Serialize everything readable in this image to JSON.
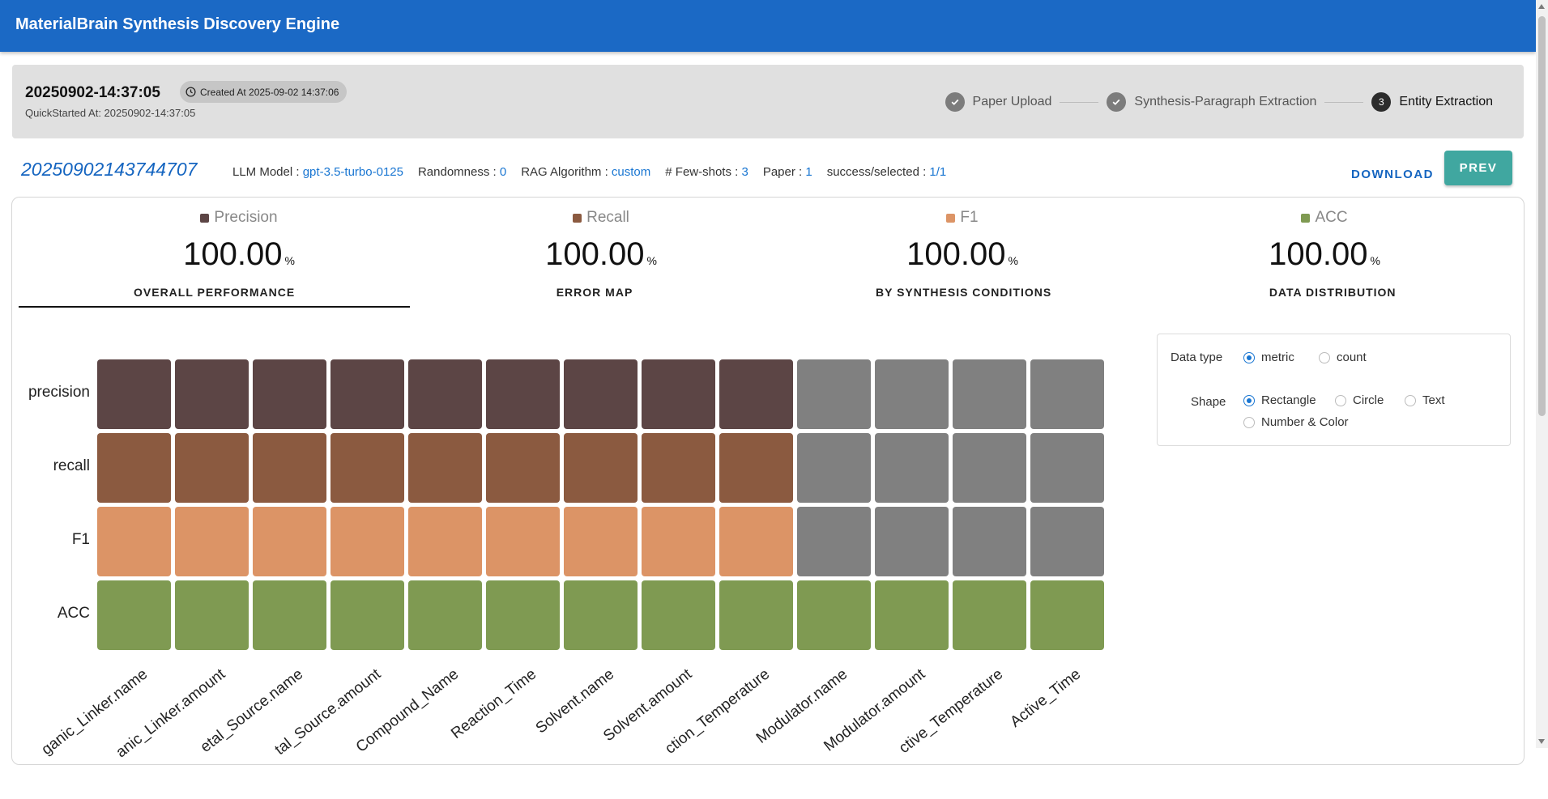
{
  "app": {
    "title": "MaterialBrain Synthesis Discovery Engine"
  },
  "run": {
    "id": "20250902-14:37:05",
    "created_at": "Created At 2025-09-02 14:37:06",
    "quickstarted_at": "QuickStarted At: 20250902-14:37:05"
  },
  "stepper": {
    "steps": [
      {
        "label": "Paper Upload",
        "state": "done"
      },
      {
        "label": "Synthesis-Paragraph Extraction",
        "state": "done"
      },
      {
        "label": "Entity Extraction",
        "state": "active",
        "number": "3"
      }
    ]
  },
  "experiment": {
    "id": "20250902143744707",
    "llm_model_label": "LLM Model : ",
    "llm_model": "gpt-3.5-turbo-0125",
    "randomness_label": "Randomness : ",
    "randomness": "0",
    "rag_label": "RAG Algorithm : ",
    "rag": "custom",
    "fewshots_label": "# Few-shots : ",
    "fewshots": "3",
    "paper_label": "Paper : ",
    "paper": "1",
    "success_label": "success/selected : ",
    "success": "1/1",
    "download_label": "DOWNLOAD",
    "prev_label": "PREV"
  },
  "metrics": [
    {
      "name": "Precision",
      "value": "100.00",
      "unit": "%",
      "color": "#5c4545"
    },
    {
      "name": "Recall",
      "value": "100.00",
      "unit": "%",
      "color": "#8b5a40"
    },
    {
      "name": "F1",
      "value": "100.00",
      "unit": "%",
      "color": "#dc9466"
    },
    {
      "name": "ACC",
      "value": "100.00",
      "unit": "%",
      "color": "#7f9a52"
    }
  ],
  "tabs": [
    {
      "label": "OVERALL PERFORMANCE",
      "active": true
    },
    {
      "label": "ERROR MAP",
      "active": false
    },
    {
      "label": "BY SYNTHESIS CONDITIONS",
      "active": false
    },
    {
      "label": "DATA DISTRIBUTION",
      "active": false
    }
  ],
  "heatmap": {
    "rows": [
      "precision",
      "recall",
      "F1",
      "ACC"
    ],
    "row_colors": [
      "#5c4545",
      "#8b5a40",
      "#dc9466",
      "#7f9a52"
    ],
    "inactive_color": "#808080",
    "columns": [
      "ganic_Linker.name",
      "anic_Linker.amount",
      "etal_Source.name",
      "tal_Source.amount",
      "Compound_Name",
      "Reaction_Time",
      "Solvent.name",
      "Solvent.amount",
      "ction_Temperature",
      "Modulator.name",
      "Modulator.amount",
      "ctive_Temperature",
      "Active_Time"
    ],
    "active": [
      [
        true,
        true,
        true,
        true,
        true,
        true,
        true,
        true,
        true,
        false,
        false,
        false,
        false
      ],
      [
        true,
        true,
        true,
        true,
        true,
        true,
        true,
        true,
        true,
        false,
        false,
        false,
        false
      ],
      [
        true,
        true,
        true,
        true,
        true,
        true,
        true,
        true,
        true,
        false,
        false,
        false,
        false
      ],
      [
        true,
        true,
        true,
        true,
        true,
        true,
        true,
        true,
        true,
        true,
        true,
        true,
        true
      ]
    ]
  },
  "options": {
    "data_type_label": "Data type",
    "data_type_options": [
      {
        "label": "metric",
        "checked": true
      },
      {
        "label": "count",
        "checked": false
      }
    ],
    "shape_label": "Shape",
    "shape_options": [
      {
        "label": "Rectangle",
        "checked": true
      },
      {
        "label": "Circle",
        "checked": false
      },
      {
        "label": "Text",
        "checked": false
      },
      {
        "label": "Number & Color",
        "checked": false
      }
    ]
  }
}
